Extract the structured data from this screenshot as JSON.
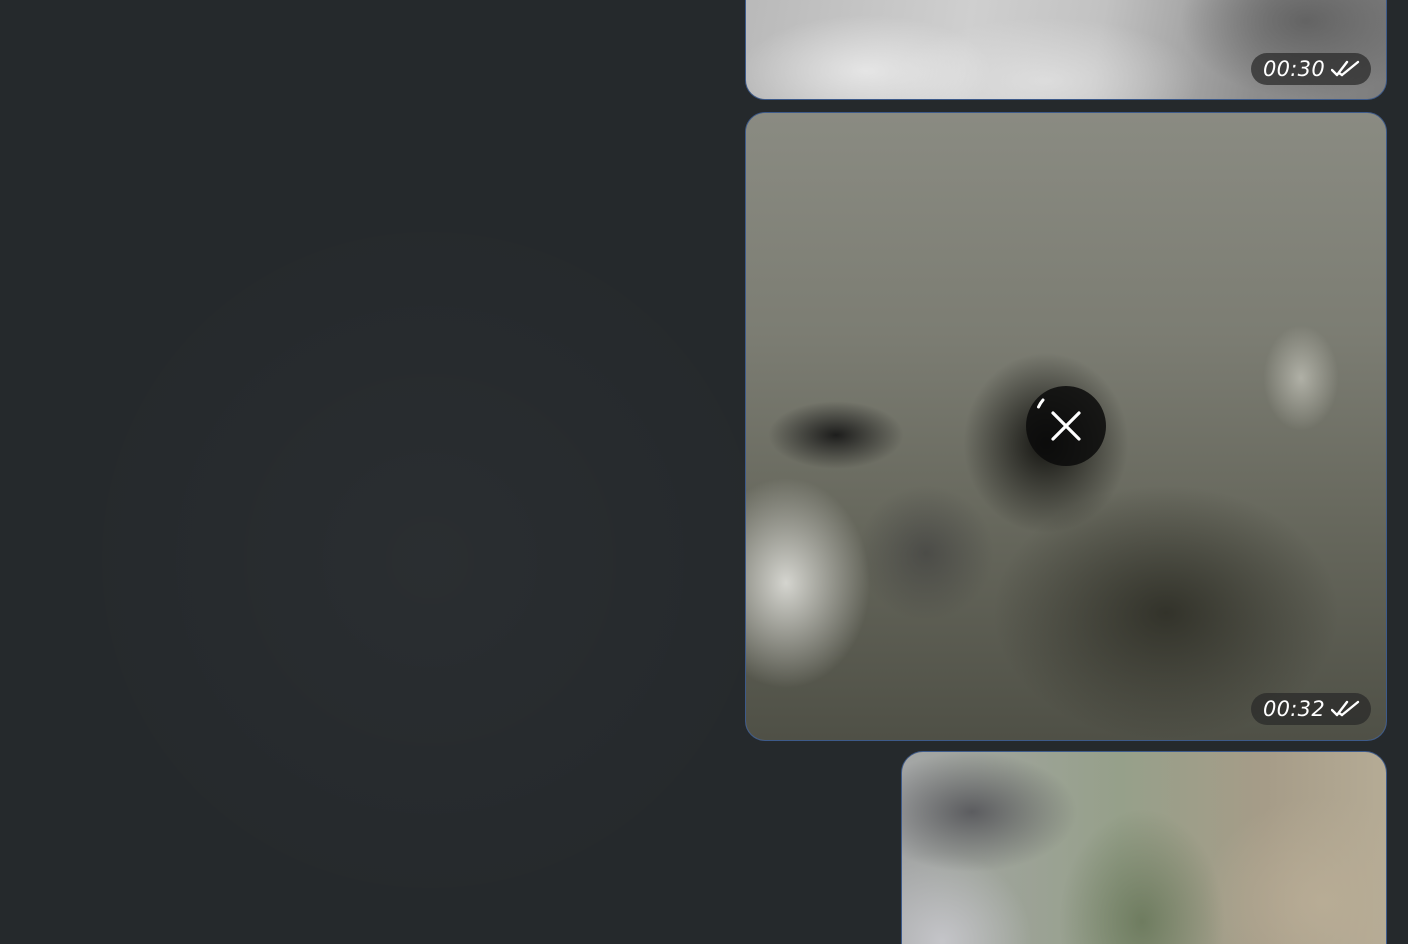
{
  "messages": [
    {
      "kind": "photo",
      "time": "00:30",
      "status_icon": "double-check-icon"
    },
    {
      "kind": "photo",
      "time": "00:32",
      "status_icon": "double-check-icon",
      "overlay_action": "cancel-download",
      "overlay_icon": "close-icon"
    },
    {
      "kind": "photo"
    }
  ],
  "colors": {
    "background": "#25292c",
    "bubble_border": "#3d5a8a",
    "badge_background": "#282828",
    "badge_text": "#ffffff"
  }
}
